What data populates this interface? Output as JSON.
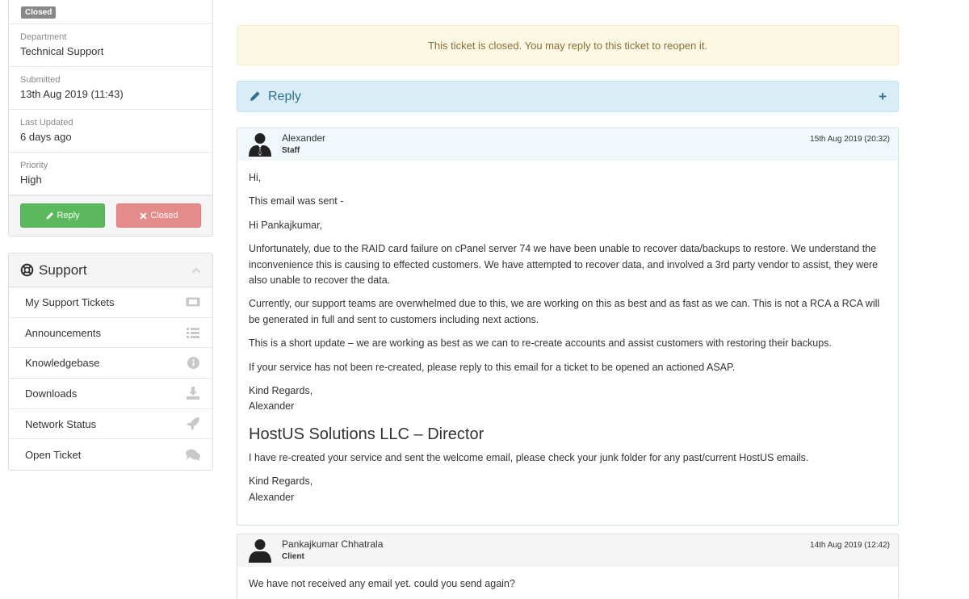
{
  "ticket_info": {
    "status": "Closed",
    "fields": [
      {
        "label": "Department",
        "value": "Technical Support"
      },
      {
        "label": "Submitted",
        "value": "13th Aug 2019 (11:43)"
      },
      {
        "label": "Last Updated",
        "value": "6 days ago"
      },
      {
        "label": "Priority",
        "value": "High"
      }
    ],
    "reply_button": "Reply",
    "closed_button": "Closed"
  },
  "support": {
    "title": "Support",
    "items": [
      {
        "label": "My Support Tickets",
        "icon": "ticket-icon"
      },
      {
        "label": "Announcements",
        "icon": "list-icon"
      },
      {
        "label": "Knowledgebase",
        "icon": "info-icon"
      },
      {
        "label": "Downloads",
        "icon": "download-icon"
      },
      {
        "label": "Network Status",
        "icon": "rocket-icon"
      },
      {
        "label": "Open Ticket",
        "icon": "comments-icon"
      }
    ]
  },
  "main": {
    "alert": "This ticket is closed. You may reply to this ticket to reopen it.",
    "reply_bar": "Reply",
    "reply_toggle": "+",
    "messages": [
      {
        "author": "Alexander",
        "role": "Staff",
        "date": "15th Aug 2019 (20:32)",
        "body": {
          "p1": "Hi,",
          "p2": "This email was sent -",
          "p3": "Hi Pankajkumar,",
          "p4": "Unfortunately, due to the RAID card failure on cPanel server 74 we have been unable to recover data/backups to restore. We understand the inconvenience this is causing to effected customers. We have attempted to recover data, and involved a 3rd party vendor to assist, they were also unable to recover the data.",
          "p5": "Currently, our support teams are overwhelmed due to this, we are working on this as best and as fast as we can. This is not a RCA a RCA will be generated in full and sent to customers including next actions.",
          "p6": "This is a short update – we are working as best as we can to re-create accounts and assist customers with restoring their backups.",
          "p7": "If your service has not been re-created, please reply to this email for a ticket to be opened an actioned ASAP.",
          "p8a": "Kind Regards,",
          "p8b": "Alexander",
          "heading": "HostUS Solutions LLC – Director",
          "p9": "I have re-created your service and sent the welcome email, please check your junk folder for any past/current HostUS emails.",
          "p10a": "Kind Regards,",
          "p10b": "Alexander"
        }
      },
      {
        "author": "Pankajkumar Chhatrala",
        "role": "Client",
        "date": "14th Aug 2019 (12:42)",
        "body": {
          "p1": "We have not received any email yet. could you send again?"
        }
      }
    ]
  }
}
